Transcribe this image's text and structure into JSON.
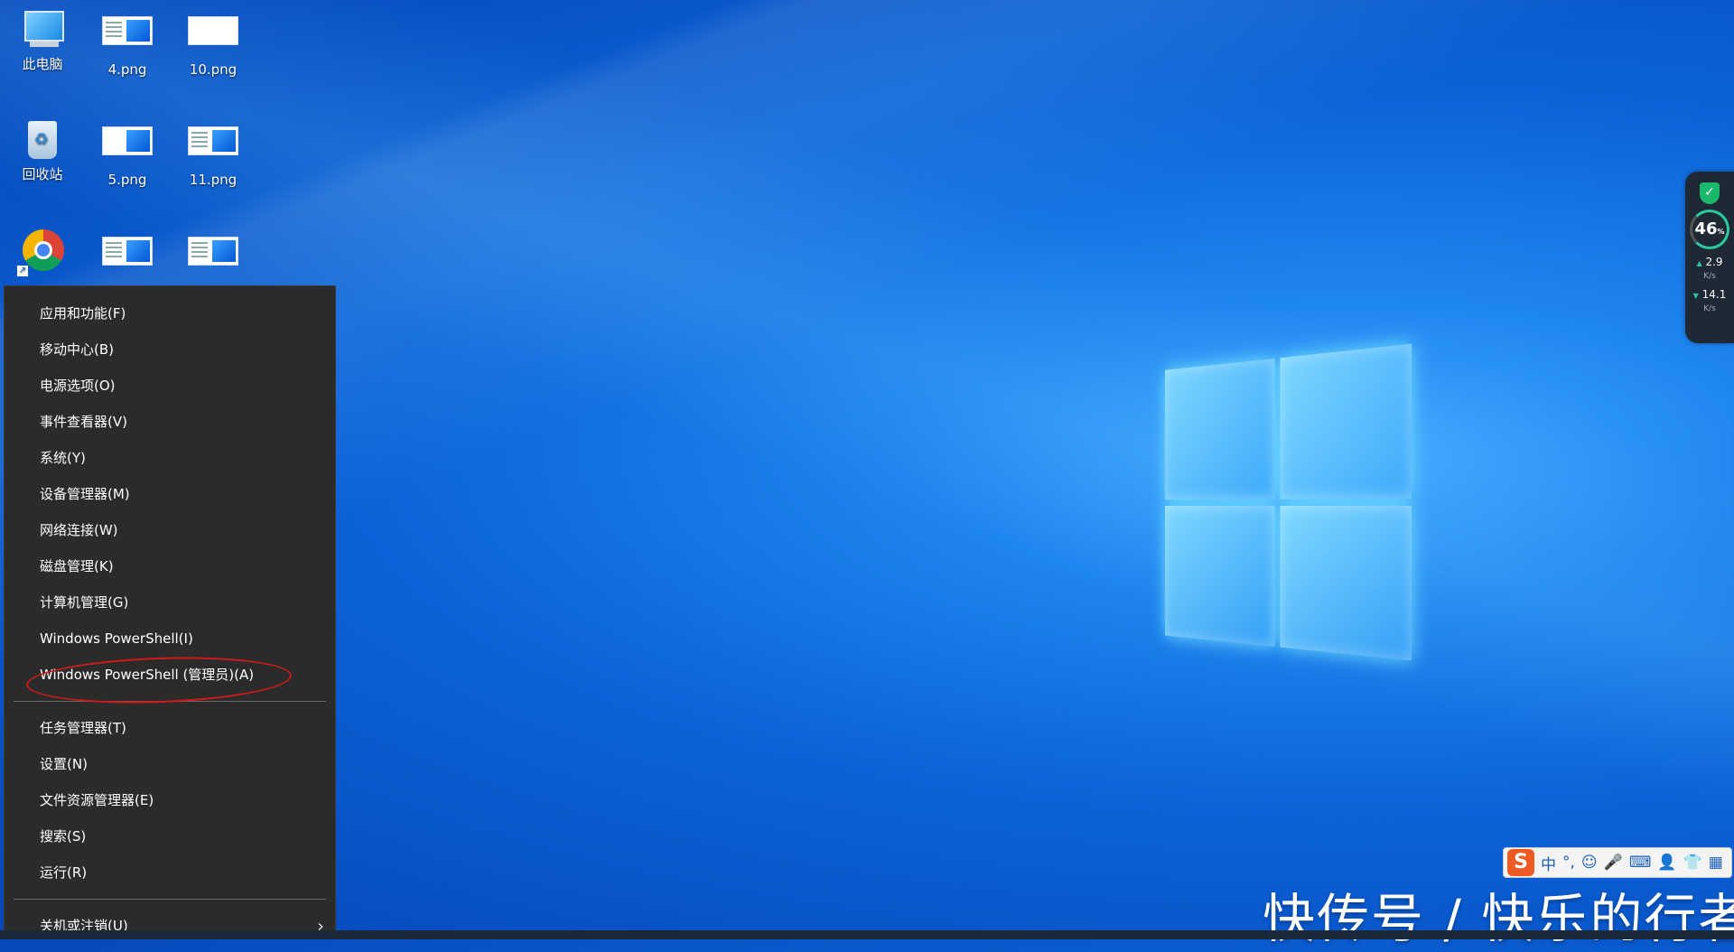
{
  "desktop": {
    "icons": [
      {
        "label": "此电脑",
        "icon": "computer-icon"
      },
      {
        "label": "4.png",
        "icon": "image-file-icon"
      },
      {
        "label": "10.png",
        "icon": "image-file-icon"
      },
      {
        "label": "回收站",
        "icon": "recycle-bin-icon"
      },
      {
        "label": "5.png",
        "icon": "image-file-icon"
      },
      {
        "label": "11.png",
        "icon": "image-file-icon"
      },
      {
        "label": "",
        "icon": "chrome-icon"
      },
      {
        "label": "",
        "icon": "image-file-icon"
      },
      {
        "label": "",
        "icon": "image-file-icon"
      }
    ]
  },
  "winx_menu": {
    "group1": [
      "应用和功能(F)",
      "移动中心(B)",
      "电源选项(O)",
      "事件查看器(V)",
      "系统(Y)",
      "设备管理器(M)",
      "网络连接(W)",
      "磁盘管理(K)",
      "计算机管理(G)",
      "Windows PowerShell(I)",
      "Windows PowerShell (管理员)(A)"
    ],
    "group2": [
      "任务管理器(T)",
      "设置(N)",
      "文件资源管理器(E)",
      "搜索(S)",
      "运行(R)"
    ],
    "group3": [
      "关机或注销(U)"
    ],
    "highlight_color": "#d21a1a"
  },
  "widget": {
    "percent": "46",
    "percent_unit": "%",
    "upload_value": "2.9",
    "upload_unit": "K/s",
    "download_value": "14.1",
    "download_unit": "K/s"
  },
  "ime_bar": {
    "logo": "S",
    "lang": "中",
    "punct": "°,"
  },
  "watermark": "快传号 / 快乐的行者",
  "colors": {
    "menu_bg": "#2b2b2b",
    "desktop_blue": "#0b63d8"
  }
}
